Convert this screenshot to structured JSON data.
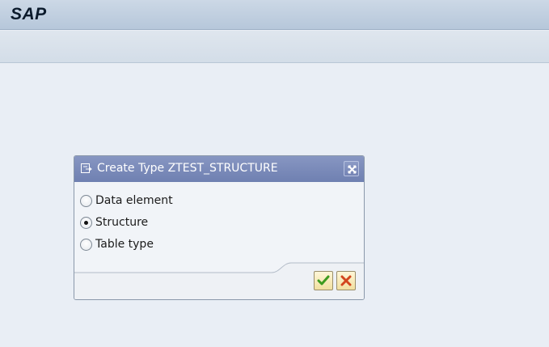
{
  "app": {
    "title": "SAP"
  },
  "dialog": {
    "title": "Create Type ZTEST_STRUCTURE",
    "options": [
      {
        "label": "Data element",
        "checked": false
      },
      {
        "label": "Structure",
        "checked": true
      },
      {
        "label": "Table type",
        "checked": false
      }
    ],
    "buttons": {
      "ok_icon": "check-icon",
      "cancel_icon": "cancel-x-icon"
    }
  },
  "colors": {
    "highlight": "#f7f500",
    "dialog_header": "#7d8dbb",
    "ok_check": "#3d9b1f",
    "cancel_x": "#d2451e"
  }
}
